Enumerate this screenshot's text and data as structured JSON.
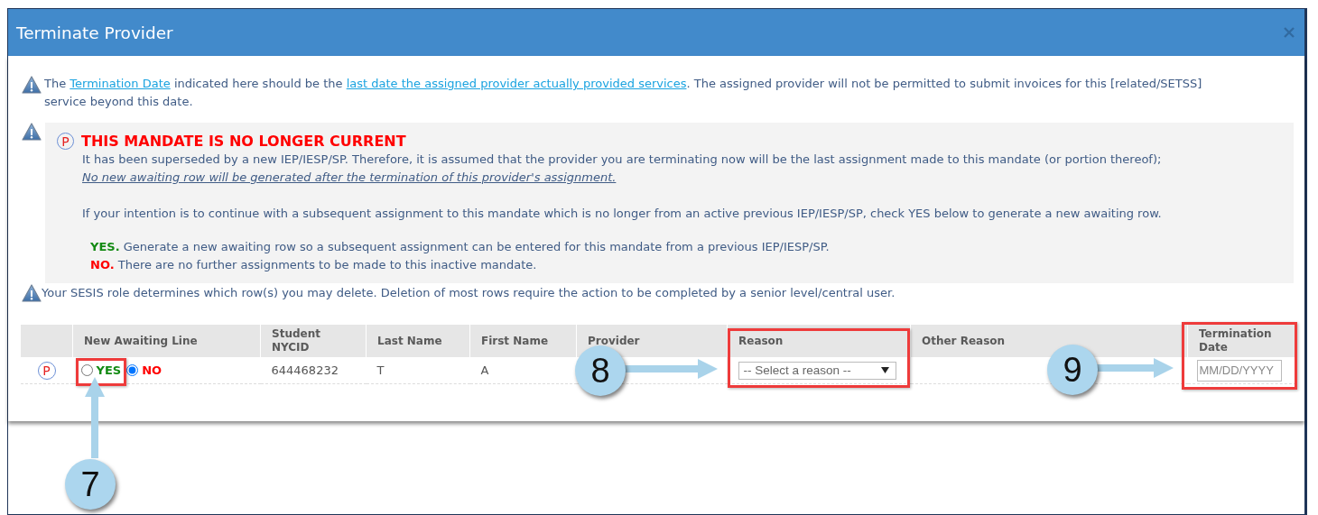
{
  "window": {
    "title": "Terminate Provider"
  },
  "notice": {
    "segments": [
      {
        "kind": "text",
        "text": "The "
      },
      {
        "kind": "link",
        "text": "Termination Date"
      },
      {
        "kind": "text",
        "text": " indicated here should be the "
      },
      {
        "kind": "link",
        "text": "last date the assigned provider actually provided services"
      },
      {
        "kind": "text",
        "text": ". The assigned provider will not be permitted to submit invoices for this [related/SETSS] service beyond this date."
      }
    ]
  },
  "mandate_box": {
    "badge": "P",
    "title": "THIS MANDATE IS NO LONGER CURRENT",
    "paragraph": "It has been superseded by a new IEP/IESP/SP. Therefore, it is assumed that the provider you are terminating now will be the last assignment made to this mandate (or portion thereof);",
    "note": "No new awaiting row will be generated after the termination of this provider's assignment.",
    "instruction": "If your intention is to continue with a subsequent assignment to this mandate which is no longer from an active previous IEP/IESP/SP, check YES below to generate a new awaiting row.",
    "options": [
      {
        "kind": "yes",
        "text": "**YES.** Generate a new awaiting row so a subsequent assignment can be entered for this mandate from a previous IEP/IESP/SP."
      },
      {
        "kind": "no",
        "text": "**NO.** There are no further assignments to be made to this inactive mandate."
      }
    ]
  },
  "role_notice": "Your SESIS role determines which row(s) you may delete. Deletion of most rows require the action to be completed by a senior level/central user.",
  "table": {
    "columns": [
      "New Awaiting Line",
      "Student NYCID",
      "Last Name",
      "First Name",
      "Provider",
      "Reason",
      "Other Reason",
      "Termination Date"
    ],
    "rows": [
      {
        "badge": "P",
        "awaiting": [
          {
            "kind": "yes",
            "label": "YES",
            "selected": false
          },
          {
            "kind": "no",
            "label": "NO",
            "selected": true
          }
        ],
        "student_nycid": "644468232",
        "last_name": "T",
        "first_name": "A",
        "reason": {
          "value": "-- Select a reason --"
        },
        "termination_date": {
          "placeholder": "MM/DD/YYYY"
        }
      }
    ]
  },
  "callouts": [
    {
      "number": "7"
    },
    {
      "number": "8"
    },
    {
      "number": "9"
    }
  ]
}
